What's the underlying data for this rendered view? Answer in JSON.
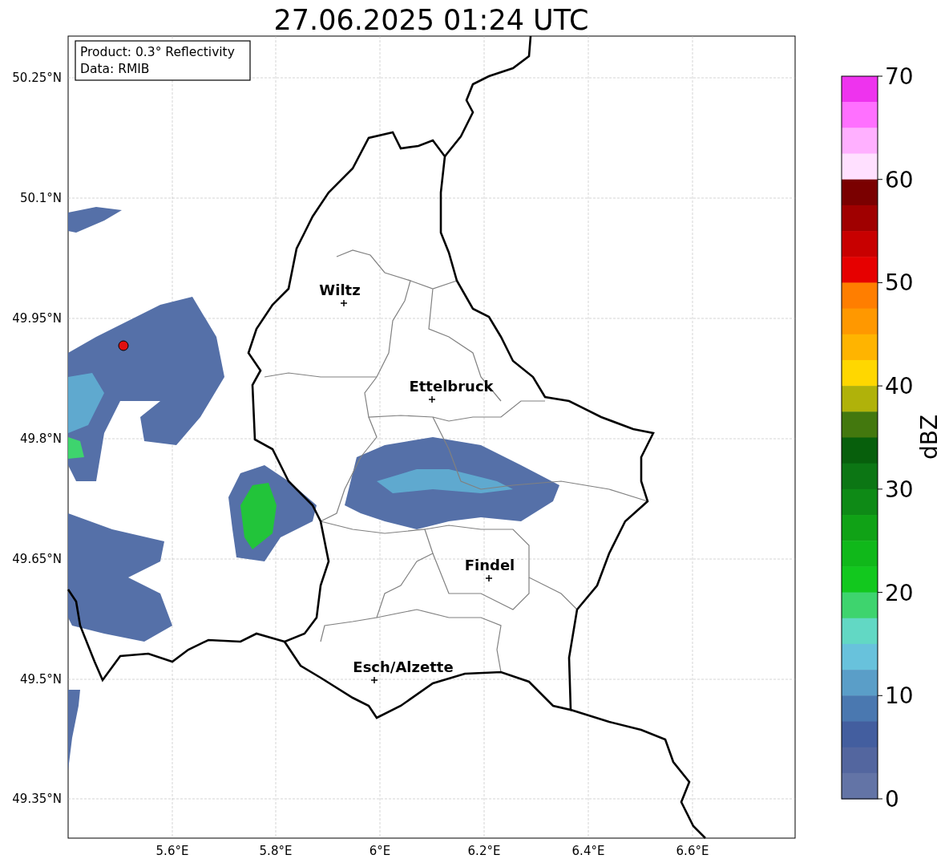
{
  "title": "27.06.2025 01:24 UTC",
  "info_box": {
    "lines": [
      "Product: 0.3° Reflectivity",
      "Data: RMIB"
    ]
  },
  "map": {
    "lon_ticks": [
      "5.6°E",
      "5.8°E",
      "6°E",
      "6.2°E",
      "6.4°E",
      "6.6°E"
    ],
    "lat_ticks": [
      "50.25°N",
      "50.1°N",
      "49.95°N",
      "49.8°N",
      "49.65°N",
      "49.5°N",
      "49.35°N"
    ],
    "cities": [
      {
        "name": "Wiltz"
      },
      {
        "name": "Ettelbruck"
      },
      {
        "name": "Findel"
      },
      {
        "name": "Esch/Alzette"
      }
    ]
  },
  "colorbar": {
    "label": "dBZ",
    "ticks": [
      "70",
      "60",
      "50",
      "40",
      "30",
      "20",
      "10",
      "0"
    ],
    "bins": [
      {
        "color": "#ee33ee"
      },
      {
        "color": "#ff70ff"
      },
      {
        "color": "#ffb0ff"
      },
      {
        "color": "#ffe0ff"
      },
      {
        "color": "#7a0000"
      },
      {
        "color": "#a00000"
      },
      {
        "color": "#c80000"
      },
      {
        "color": "#e60000"
      },
      {
        "color": "#ff7e00"
      },
      {
        "color": "#ff9800"
      },
      {
        "color": "#ffb400"
      },
      {
        "color": "#ffd700"
      },
      {
        "color": "#b0b20a"
      },
      {
        "color": "#43780e"
      },
      {
        "color": "#075f0c"
      },
      {
        "color": "#0c7614"
      },
      {
        "color": "#0e8a16"
      },
      {
        "color": "#10a216"
      },
      {
        "color": "#10b81a"
      },
      {
        "color": "#12c81e"
      },
      {
        "color": "#3ed46e"
      },
      {
        "color": "#62d8c4"
      },
      {
        "color": "#68c2dc"
      },
      {
        "color": "#5a9ec8"
      },
      {
        "color": "#4a78b0"
      },
      {
        "color": "#435e9f"
      },
      {
        "color": "#53669f"
      },
      {
        "color": "#6374a6"
      }
    ]
  }
}
